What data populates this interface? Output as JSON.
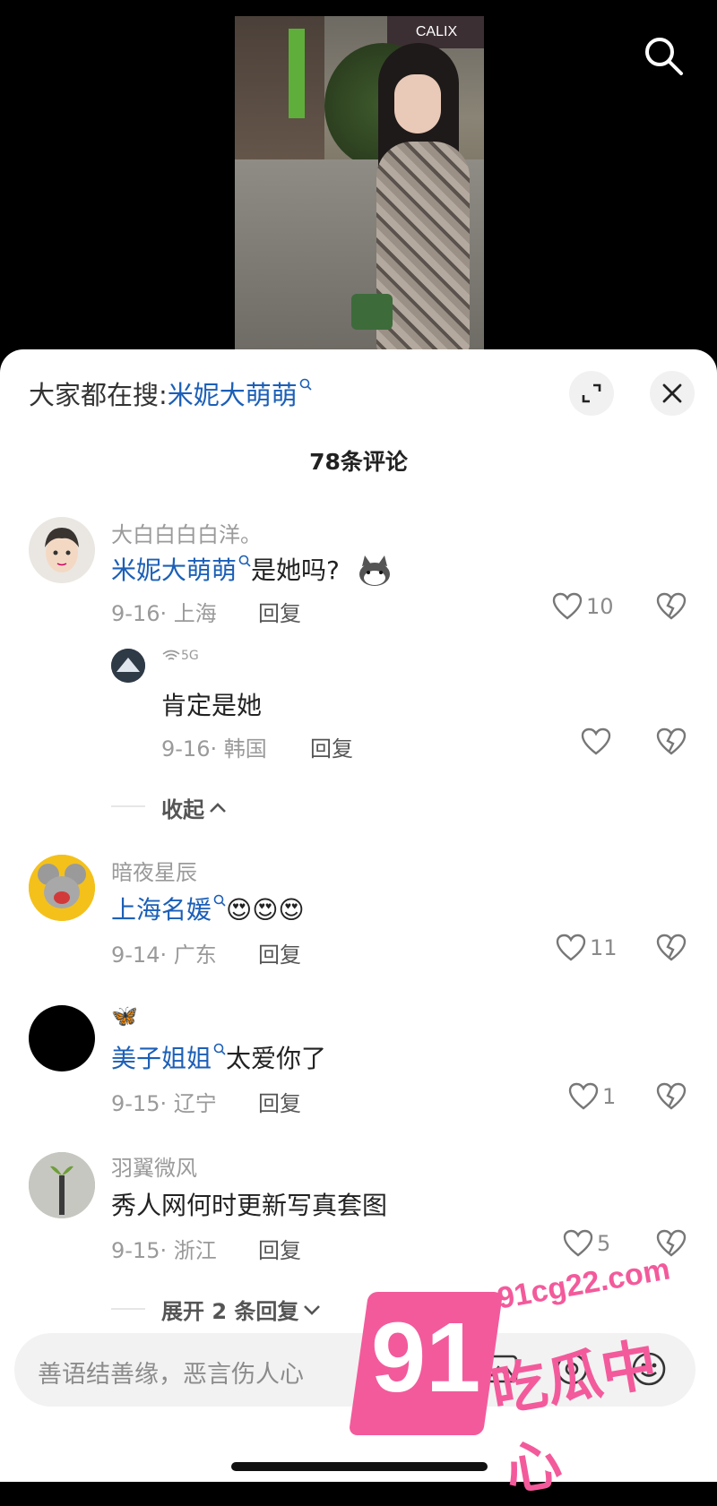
{
  "video": {
    "sign_text": "CALIX"
  },
  "header": {
    "hot_search_prefix": "大家都在搜:",
    "hot_search_term": "米妮大萌萌",
    "comment_count": "78条评论"
  },
  "comments": [
    {
      "user": "大白白白白洋。",
      "tag": "米妮大萌萌",
      "text": "是她吗?",
      "date_loc": "9-16· 上海",
      "reply": "回复",
      "likes": "10"
    },
    {
      "user": "5G",
      "text": "肯定是她",
      "date_loc": "9-16· 韩国",
      "reply": "回复",
      "likes": ""
    },
    {
      "user": "暗夜星辰",
      "tag": "上海名媛",
      "text": "😍😍😍",
      "date_loc": "9-14· 广东",
      "reply": "回复",
      "likes": "11"
    },
    {
      "user": "🦋",
      "tag": "美子姐姐",
      "text": "太爱你了",
      "date_loc": "9-15· 辽宁",
      "reply": "回复",
      "likes": "1"
    },
    {
      "user": "羽翼微风",
      "text": "秀人网何时更新写真套图",
      "date_loc": "9-15· 浙江",
      "reply": "回复",
      "likes": "5"
    }
  ],
  "fold_label": "收起",
  "expand_label": "展开 2 条回复",
  "input": {
    "placeholder": "善语结善缘，恶言伤人心"
  },
  "watermark": {
    "number": "91",
    "url": "91cg22.com",
    "name": "吃瓜中心"
  },
  "colors": {
    "accent_blue": "#1c5fb7",
    "watermark_pink": "#f35a9b"
  }
}
